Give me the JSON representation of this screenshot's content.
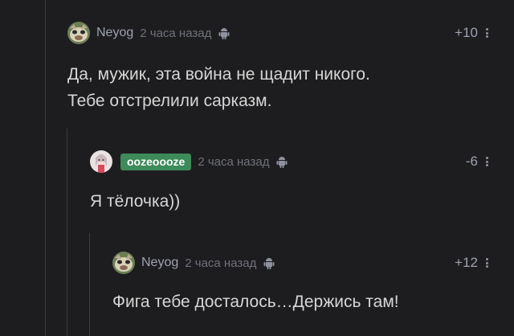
{
  "comments": [
    {
      "author": "Neyog",
      "time": "2 часа назад",
      "rating": "+10",
      "text_lines": [
        "Да, мужик, эта война не щадит никого.",
        "Тебе отстрелили сарказм."
      ]
    },
    {
      "author": "oozeoooze",
      "time": "2 часа назад",
      "rating": "-6",
      "text_lines": [
        "Я тёлочка))"
      ]
    },
    {
      "author": "Neyog",
      "time": "2 часа назад",
      "rating": "+12",
      "text_lines": [
        "Фига тебе досталось…Держись там!"
      ]
    }
  ],
  "colors": {
    "background": "#1d1d1f",
    "badge": "#3d8a5a",
    "meta_text": "#9ea2b0",
    "body_text": "#d6d6d6",
    "thread_line": "#3c3c40"
  },
  "icons": {
    "platform": "android-icon",
    "menu": "more-vertical-icon"
  }
}
